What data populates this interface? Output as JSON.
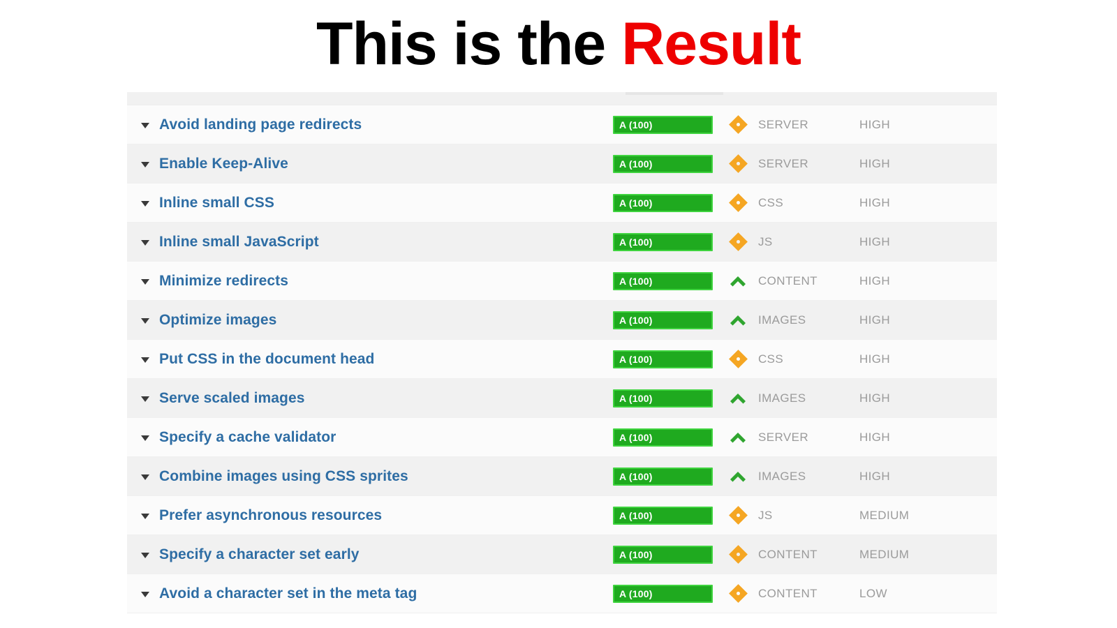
{
  "title": {
    "text_plain": "This is the ",
    "text_accent": "Result",
    "accent_color": "#ee0000",
    "plain_color": "#000000"
  },
  "table": {
    "colors": {
      "link": "#2e6da4",
      "grade_fill": "#1faa1f",
      "grade_border": "#3fd43f",
      "grade_text": "#ffffff",
      "diamond": "#f5a623",
      "chevron_up": "#2fa52f",
      "meta_text": "#9b9b9b",
      "row_bg": "#fbfbfb",
      "row_bg_alt": "#f1f1f1"
    },
    "rows": [
      {
        "caret_icon": "caret-down-icon",
        "name": "Avoid landing page redirects",
        "grade": "A (100)",
        "trend_icon": "diamond-icon",
        "category": "SERVER",
        "priority": "HIGH"
      },
      {
        "caret_icon": "caret-down-icon",
        "name": "Enable Keep-Alive",
        "grade": "A (100)",
        "trend_icon": "diamond-icon",
        "category": "SERVER",
        "priority": "HIGH"
      },
      {
        "caret_icon": "caret-down-icon",
        "name": "Inline small CSS",
        "grade": "A (100)",
        "trend_icon": "diamond-icon",
        "category": "CSS",
        "priority": "HIGH"
      },
      {
        "caret_icon": "caret-down-icon",
        "name": "Inline small JavaScript",
        "grade": "A (100)",
        "trend_icon": "diamond-icon",
        "category": "JS",
        "priority": "HIGH"
      },
      {
        "caret_icon": "caret-down-icon",
        "name": "Minimize redirects",
        "grade": "A (100)",
        "trend_icon": "chevron-up-icon",
        "category": "CONTENT",
        "priority": "HIGH"
      },
      {
        "caret_icon": "caret-down-icon",
        "name": "Optimize images",
        "grade": "A (100)",
        "trend_icon": "chevron-up-icon",
        "category": "IMAGES",
        "priority": "HIGH"
      },
      {
        "caret_icon": "caret-down-icon",
        "name": "Put CSS in the document head",
        "grade": "A (100)",
        "trend_icon": "diamond-icon",
        "category": "CSS",
        "priority": "HIGH"
      },
      {
        "caret_icon": "caret-down-icon",
        "name": "Serve scaled images",
        "grade": "A (100)",
        "trend_icon": "chevron-up-icon",
        "category": "IMAGES",
        "priority": "HIGH"
      },
      {
        "caret_icon": "caret-down-icon",
        "name": "Specify a cache validator",
        "grade": "A (100)",
        "trend_icon": "chevron-up-icon",
        "category": "SERVER",
        "priority": "HIGH"
      },
      {
        "caret_icon": "caret-down-icon",
        "name": "Combine images using CSS sprites",
        "grade": "A (100)",
        "trend_icon": "chevron-up-icon",
        "category": "IMAGES",
        "priority": "HIGH"
      },
      {
        "caret_icon": "caret-down-icon",
        "name": "Prefer asynchronous resources",
        "grade": "A (100)",
        "trend_icon": "diamond-icon",
        "category": "JS",
        "priority": "MEDIUM"
      },
      {
        "caret_icon": "caret-down-icon",
        "name": "Specify a character set early",
        "grade": "A (100)",
        "trend_icon": "diamond-icon",
        "category": "CONTENT",
        "priority": "MEDIUM"
      },
      {
        "caret_icon": "caret-down-icon",
        "name": "Avoid a character set in the meta tag",
        "grade": "A (100)",
        "trend_icon": "diamond-icon",
        "category": "CONTENT",
        "priority": "LOW"
      }
    ]
  }
}
